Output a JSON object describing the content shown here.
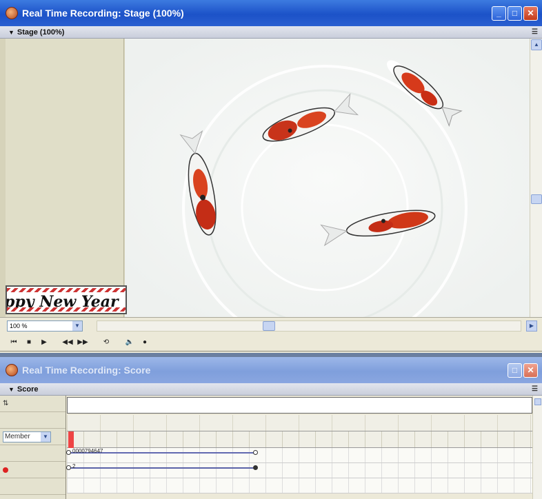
{
  "stage_window": {
    "title": "Real Time Recording: Stage (100%)",
    "panel_label": "Stage (100%)",
    "zoom_value": "100 %",
    "banner_text": "ppy New Year"
  },
  "score_window": {
    "title": "Real Time Recording: Score",
    "panel_label": "Score",
    "member_select": "Member",
    "channel_1_sprite": "0000794647",
    "channel_2_sprite": "2"
  },
  "icons": [
    "app-icon",
    "minimize-icon",
    "maximize-icon",
    "close-icon",
    "rewind-icon",
    "stop-icon",
    "play-icon",
    "step-back-icon",
    "step-forward-icon",
    "loop-icon",
    "volume-icon",
    "record-icon"
  ],
  "colors": {
    "title_active": "#1c52c8",
    "title_inactive": "#7f9fdc",
    "close": "#c33c1c"
  }
}
